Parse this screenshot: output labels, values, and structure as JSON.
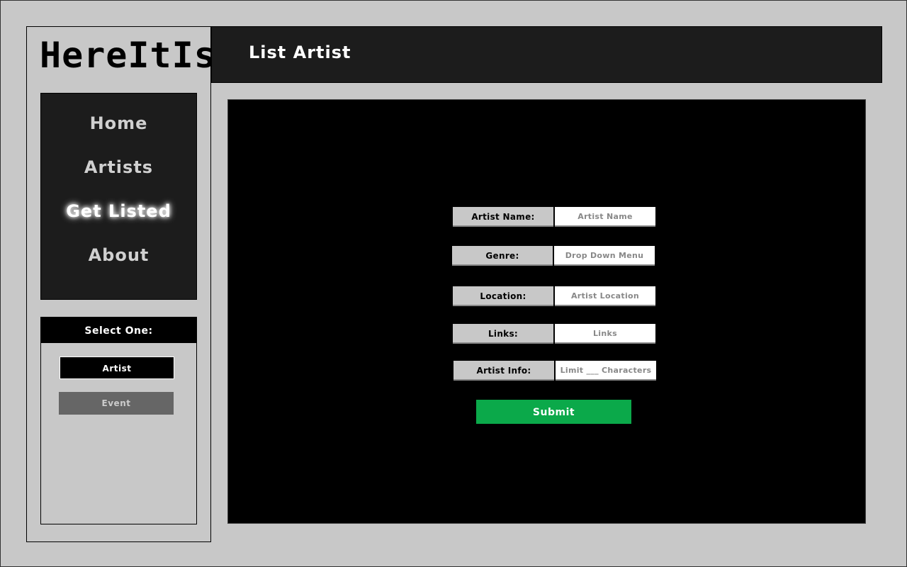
{
  "brand": {
    "logo_text": "HereItIs"
  },
  "nav": {
    "items": [
      {
        "label": "Home"
      },
      {
        "label": "Artists"
      },
      {
        "label": "Get Listed",
        "active": true
      },
      {
        "label": "About"
      }
    ]
  },
  "select_panel": {
    "header": "Select One:",
    "options": [
      {
        "label": "Artist",
        "selected": true
      },
      {
        "label": "Event",
        "selected": false
      }
    ]
  },
  "header": {
    "title": "List Artist"
  },
  "form": {
    "fields": [
      {
        "label": "Artist Name:",
        "placeholder": "Artist Name",
        "value": ""
      },
      {
        "label": "Genre:",
        "placeholder": "Drop Down Menu",
        "value": ""
      },
      {
        "label": "Location:",
        "placeholder": "Artist Location",
        "value": ""
      },
      {
        "label": "Links:",
        "placeholder": "Links",
        "value": ""
      },
      {
        "label": "Artist Info:",
        "placeholder": "Limit ___ Characters",
        "value": ""
      }
    ],
    "submit_label": "Submit"
  },
  "colors": {
    "background": "#c8c8c8",
    "dark_panel": "#1c1c1c",
    "main_panel": "#000000",
    "submit": "#0ba94a",
    "event_button": "#666666"
  }
}
